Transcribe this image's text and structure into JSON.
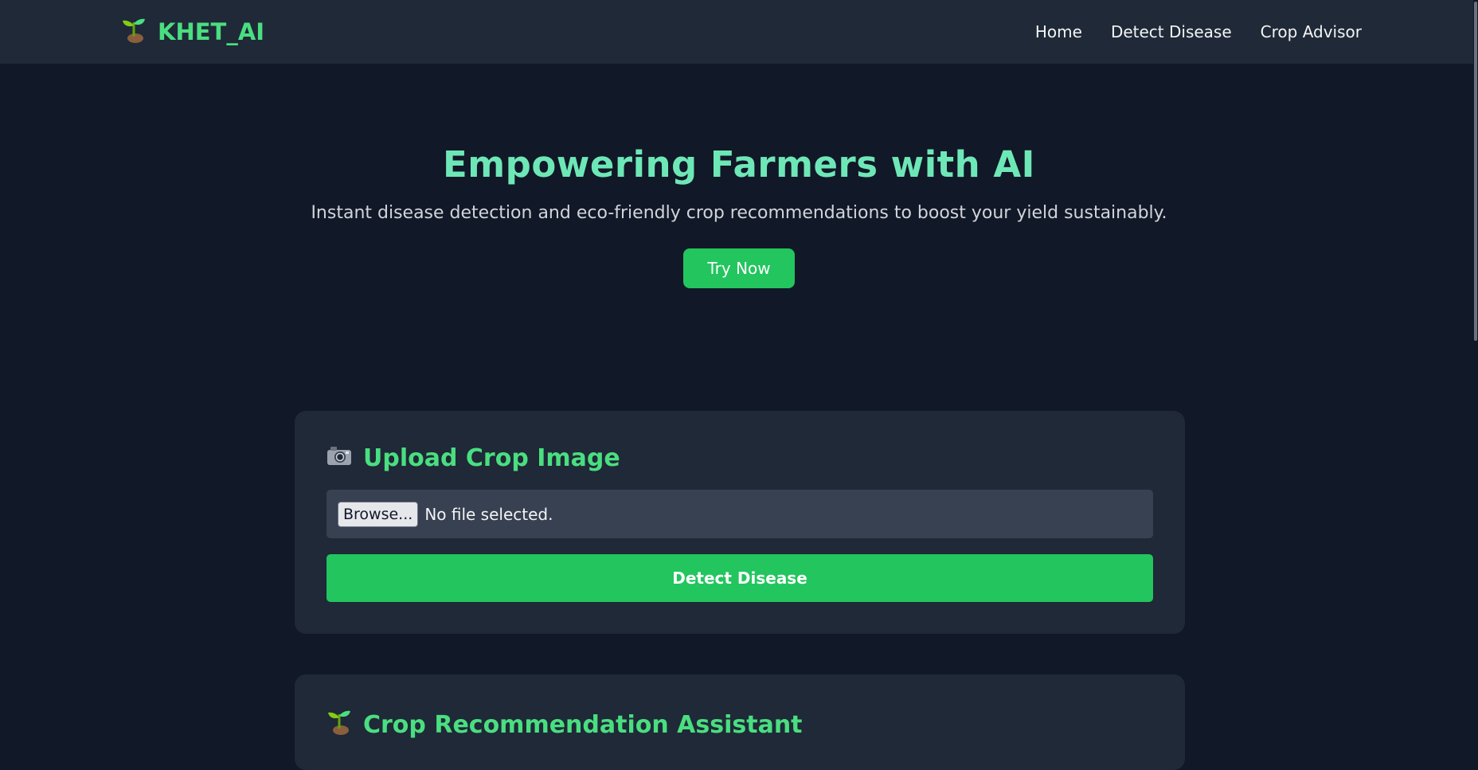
{
  "navbar": {
    "brand_icon": "seedling-icon",
    "brand_text": "KHET_AI",
    "links": [
      "Home",
      "Detect Disease",
      "Crop Advisor"
    ]
  },
  "hero": {
    "title": "Empowering Farmers with AI",
    "subtitle": "Instant disease detection and eco-friendly crop recommendations to boost your yield sustainably.",
    "cta_label": "Try Now"
  },
  "upload_card": {
    "icon": "camera-icon",
    "title": "Upload Crop Image",
    "browse_label": "Browse...",
    "file_status": "No file selected.",
    "detect_label": "Detect Disease"
  },
  "recommend_card": {
    "icon": "seedling-icon",
    "title": "Crop Recommendation Assistant"
  },
  "colors": {
    "background": "#111827",
    "surface": "#1f2937",
    "accent": "#22c55e",
    "accent_text": "#4ade80",
    "hero_title": "#6ee7b7"
  }
}
